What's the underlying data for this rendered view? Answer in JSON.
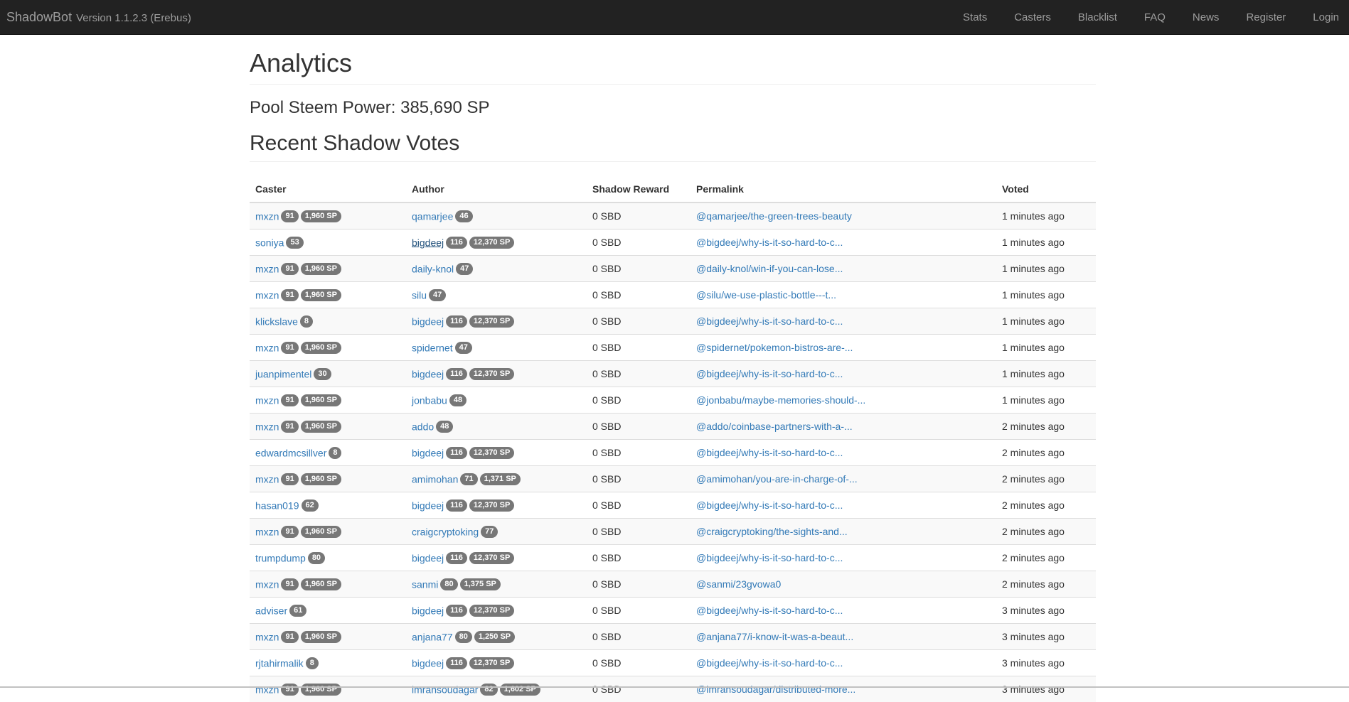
{
  "navbar": {
    "brand": "ShadowBot",
    "version": "Version 1.1.2.3 (Erebus)",
    "links": [
      "Stats",
      "Casters",
      "Blacklist",
      "FAQ",
      "News",
      "Register",
      "Login"
    ]
  },
  "page": {
    "title": "Analytics",
    "pool_power": "Pool Steem Power: 385,690 SP",
    "section_title": "Recent Shadow Votes"
  },
  "table": {
    "columns": [
      "Caster",
      "Author",
      "Shadow Reward",
      "Permalink",
      "Voted"
    ],
    "rows": [
      {
        "caster": "mxzn",
        "caster_badges": [
          "91",
          "1,960 SP"
        ],
        "author": "qamarjee",
        "author_badges": [
          "46"
        ],
        "reward": "0 SBD",
        "permalink": "@qamarjee/the-green-trees-beauty",
        "voted": "1 minutes ago"
      },
      {
        "caster": "soniya",
        "caster_badges": [
          "53"
        ],
        "author": "bigdeej",
        "author_badges": [
          "116",
          "12,370 SP"
        ],
        "reward": "0 SBD",
        "permalink": "@bigdeej/why-is-it-so-hard-to-c...",
        "voted": "1 minutes ago"
      },
      {
        "caster": "mxzn",
        "caster_badges": [
          "91",
          "1,960 SP"
        ],
        "author": "daily-knol",
        "author_badges": [
          "47"
        ],
        "reward": "0 SBD",
        "permalink": "@daily-knol/win-if-you-can-lose...",
        "voted": "1 minutes ago"
      },
      {
        "caster": "mxzn",
        "caster_badges": [
          "91",
          "1,960 SP"
        ],
        "author": "silu",
        "author_badges": [
          "47"
        ],
        "reward": "0 SBD",
        "permalink": "@silu/we-use-plastic-bottle---t...",
        "voted": "1 minutes ago"
      },
      {
        "caster": "klickslave",
        "caster_badges": [
          "8"
        ],
        "author": "bigdeej",
        "author_badges": [
          "116",
          "12,370 SP"
        ],
        "reward": "0 SBD",
        "permalink": "@bigdeej/why-is-it-so-hard-to-c...",
        "voted": "1 minutes ago"
      },
      {
        "caster": "mxzn",
        "caster_badges": [
          "91",
          "1,960 SP"
        ],
        "author": "spidernet",
        "author_badges": [
          "47"
        ],
        "reward": "0 SBD",
        "permalink": "@spidernet/pokemon-bistros-are-...",
        "voted": "1 minutes ago"
      },
      {
        "caster": "juanpimentel",
        "caster_badges": [
          "30"
        ],
        "author": "bigdeej",
        "author_badges": [
          "116",
          "12,370 SP"
        ],
        "reward": "0 SBD",
        "permalink": "@bigdeej/why-is-it-so-hard-to-c...",
        "voted": "1 minutes ago"
      },
      {
        "caster": "mxzn",
        "caster_badges": [
          "91",
          "1,960 SP"
        ],
        "author": "jonbabu",
        "author_badges": [
          "48"
        ],
        "reward": "0 SBD",
        "permalink": "@jonbabu/maybe-memories-should-...",
        "voted": "1 minutes ago"
      },
      {
        "caster": "mxzn",
        "caster_badges": [
          "91",
          "1,960 SP"
        ],
        "author": "addo",
        "author_badges": [
          "48"
        ],
        "reward": "0 SBD",
        "permalink": "@addo/coinbase-partners-with-a-...",
        "voted": "2 minutes ago"
      },
      {
        "caster": "edwardmcsillver",
        "caster_badges": [
          "8"
        ],
        "author": "bigdeej",
        "author_badges": [
          "116",
          "12,370 SP"
        ],
        "reward": "0 SBD",
        "permalink": "@bigdeej/why-is-it-so-hard-to-c...",
        "voted": "2 minutes ago"
      },
      {
        "caster": "mxzn",
        "caster_badges": [
          "91",
          "1,960 SP"
        ],
        "author": "amimohan",
        "author_badges": [
          "71",
          "1,371 SP"
        ],
        "reward": "0 SBD",
        "permalink": "@amimohan/you-are-in-charge-of-...",
        "voted": "2 minutes ago"
      },
      {
        "caster": "hasan019",
        "caster_badges": [
          "62"
        ],
        "author": "bigdeej",
        "author_badges": [
          "116",
          "12,370 SP"
        ],
        "reward": "0 SBD",
        "permalink": "@bigdeej/why-is-it-so-hard-to-c...",
        "voted": "2 minutes ago"
      },
      {
        "caster": "mxzn",
        "caster_badges": [
          "91",
          "1,960 SP"
        ],
        "author": "craigcryptoking",
        "author_badges": [
          "77"
        ],
        "reward": "0 SBD",
        "permalink": "@craigcryptoking/the-sights-and...",
        "voted": "2 minutes ago"
      },
      {
        "caster": "trumpdump",
        "caster_badges": [
          "80"
        ],
        "author": "bigdeej",
        "author_badges": [
          "116",
          "12,370 SP"
        ],
        "reward": "0 SBD",
        "permalink": "@bigdeej/why-is-it-so-hard-to-c...",
        "voted": "2 minutes ago"
      },
      {
        "caster": "mxzn",
        "caster_badges": [
          "91",
          "1,960 SP"
        ],
        "author": "sanmi",
        "author_badges": [
          "80",
          "1,375 SP"
        ],
        "reward": "0 SBD",
        "permalink": "@sanmi/23gvowa0",
        "voted": "2 minutes ago"
      },
      {
        "caster": "adviser",
        "caster_badges": [
          "61"
        ],
        "author": "bigdeej",
        "author_badges": [
          "116",
          "12,370 SP"
        ],
        "reward": "0 SBD",
        "permalink": "@bigdeej/why-is-it-so-hard-to-c...",
        "voted": "3 minutes ago"
      },
      {
        "caster": "mxzn",
        "caster_badges": [
          "91",
          "1,960 SP"
        ],
        "author": "anjana77",
        "author_badges": [
          "80",
          "1,250 SP"
        ],
        "reward": "0 SBD",
        "permalink": "@anjana77/i-know-it-was-a-beaut...",
        "voted": "3 minutes ago"
      },
      {
        "caster": "rjtahirmalik",
        "caster_badges": [
          "8"
        ],
        "author": "bigdeej",
        "author_badges": [
          "116",
          "12,370 SP"
        ],
        "reward": "0 SBD",
        "permalink": "@bigdeej/why-is-it-so-hard-to-c...",
        "voted": "3 minutes ago"
      },
      {
        "caster": "mxzn",
        "caster_badges": [
          "91",
          "1,960 SP"
        ],
        "author": "imransoudagar",
        "author_badges": [
          "82",
          "1,602 SP"
        ],
        "reward": "0 SBD",
        "permalink": "@imransoudagar/distributed-more...",
        "voted": "3 minutes ago"
      }
    ]
  }
}
